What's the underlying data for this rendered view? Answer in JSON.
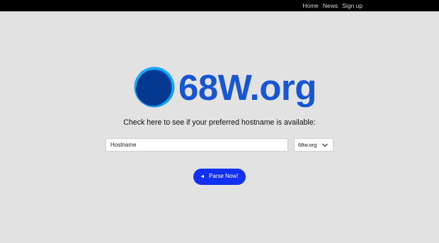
{
  "nav": {
    "items": [
      {
        "label": "Home"
      },
      {
        "label": "News"
      },
      {
        "label": "Sign up"
      }
    ]
  },
  "logo": {
    "text": "68W.org",
    "icon": "globe-icon",
    "color": "#1656d3"
  },
  "checker": {
    "prompt": "Check here to see if your preferred hostname is available:",
    "hostname_placeholder": "Hostname",
    "hostname_value": "",
    "domain_selected": "68w.org",
    "parse_button_label": "Parse Now!",
    "parse_button_icon": "play-icon",
    "button_color": "#1231f5"
  }
}
